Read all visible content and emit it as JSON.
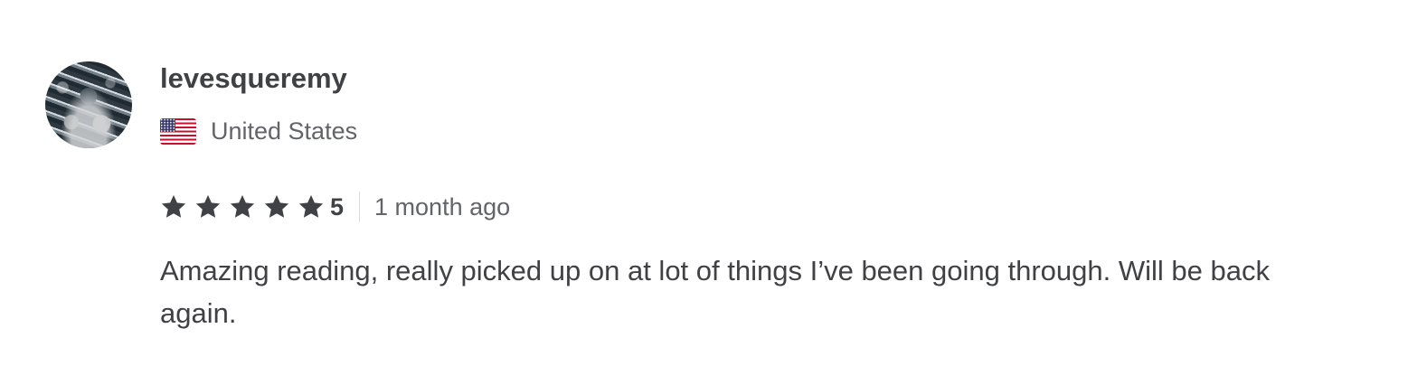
{
  "review": {
    "username": "levesqueremy",
    "country": "United States",
    "flag_icon": "us-flag-icon",
    "rating": {
      "stars_filled": 5,
      "stars_total": 5,
      "value_label": "5",
      "star_color": "#404145"
    },
    "time_ago": "1 month ago",
    "text": "Amazing reading, really picked up on at lot of things I’ve been going through. Will be back again."
  }
}
